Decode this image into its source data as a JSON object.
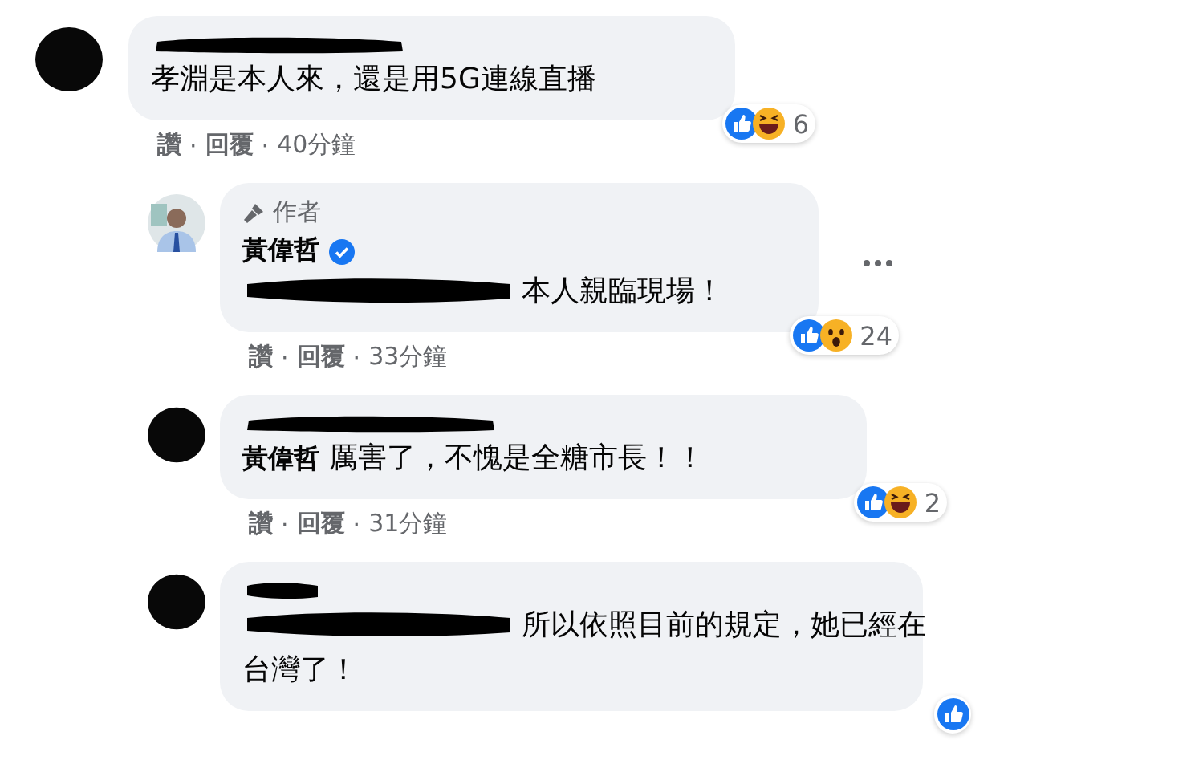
{
  "comments": [
    {
      "avatar": {
        "kind": "redacted"
      },
      "author_redacted": true,
      "text": "孝淵是本人來，還是用5G連線直播",
      "reactions": [
        {
          "kind": "like"
        },
        {
          "kind": "haha"
        }
      ],
      "reaction_count": "6",
      "actions": [
        {
          "kind": "link",
          "label": "讚"
        },
        {
          "kind": "separator",
          "label": "·"
        },
        {
          "kind": "link",
          "label": "回覆"
        },
        {
          "kind": "separator",
          "label": "·"
        },
        {
          "kind": "time",
          "label": "40分鐘"
        }
      ],
      "children": [
        {
          "avatar": {
            "kind": "photo"
          },
          "badge": "作者",
          "author": "黃偉哲",
          "verified": true,
          "mention_redacted": true,
          "text": "本人親臨現場！",
          "reactions": [
            {
              "kind": "like"
            },
            {
              "kind": "wow"
            }
          ],
          "reaction_count": "24",
          "actions": [
            {
              "kind": "link",
              "label": "讚"
            },
            {
              "kind": "separator",
              "label": "·"
            },
            {
              "kind": "link",
              "label": "回覆"
            },
            {
              "kind": "separator",
              "label": "·"
            },
            {
              "kind": "time",
              "label": "33分鐘"
            }
          ],
          "more": true
        },
        {
          "avatar": {
            "kind": "redacted"
          },
          "author_redacted": true,
          "mention": "黃偉哲",
          "text": "厲害了，不愧是全糖市長！！",
          "reactions": [
            {
              "kind": "like"
            },
            {
              "kind": "haha"
            }
          ],
          "reaction_count": "2",
          "actions": [
            {
              "kind": "link",
              "label": "讚"
            },
            {
              "kind": "separator",
              "label": "·"
            },
            {
              "kind": "link",
              "label": "回覆"
            },
            {
              "kind": "separator",
              "label": "·"
            },
            {
              "kind": "time",
              "label": "31分鐘"
            }
          ]
        },
        {
          "avatar": {
            "kind": "redacted"
          },
          "author_redacted": true,
          "mention_redacted": true,
          "text": "所以依照目前的規定，她已經在",
          "text_2": "台灣了！",
          "reactions": [
            {
              "kind": "like"
            }
          ]
        }
      ]
    }
  ]
}
